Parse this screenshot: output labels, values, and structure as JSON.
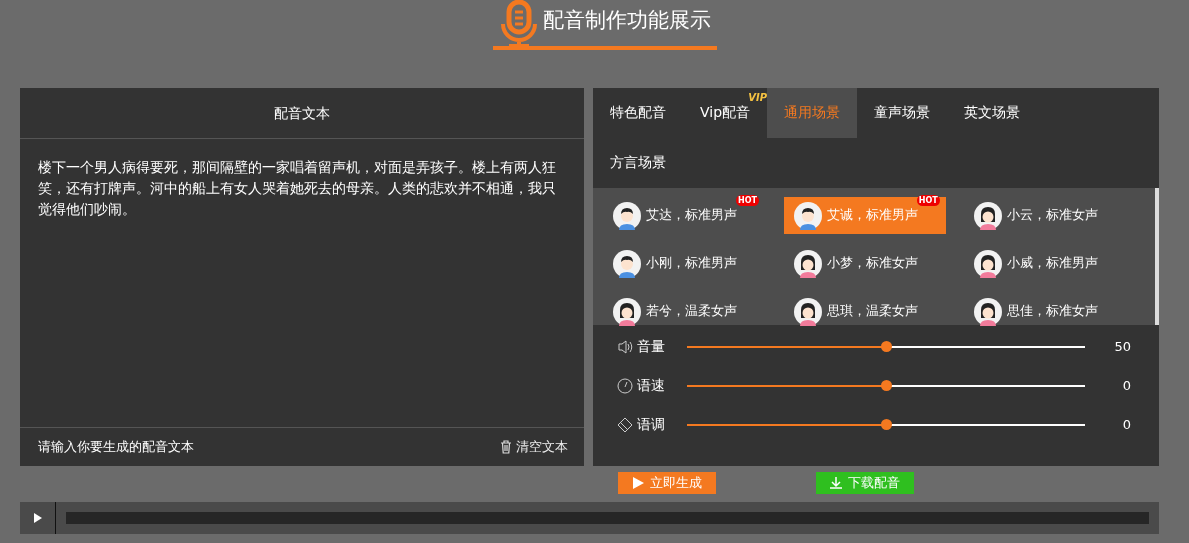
{
  "header": {
    "title": "配音制作功能展示"
  },
  "text_panel": {
    "title": "配音文本",
    "content": "楼下一个男人病得要死，那间隔壁的一家唱着留声机，对面是弄孩子。楼上有两人狂笑，还有打牌声。河中的船上有女人哭着她死去的母亲。人类的悲欢并不相通，我只觉得他们吵闹。",
    "hint": "请输入你要生成的配音文本",
    "clear_button": "清空文本"
  },
  "tabs": [
    {
      "label": "特色配音",
      "selected": false
    },
    {
      "label": "Vip配音",
      "selected": false,
      "badge": "VIP"
    },
    {
      "label": "通用场景",
      "selected": true
    },
    {
      "label": "童声场景",
      "selected": false
    },
    {
      "label": "英文场景",
      "selected": false
    },
    {
      "label": "方言场景",
      "selected": false
    }
  ],
  "voices": [
    {
      "label": "艾达，标准男声",
      "kind": "male",
      "selected": false,
      "badge": "HOT"
    },
    {
      "label": "艾诚，标准男声",
      "kind": "male",
      "selected": true,
      "badge": "HOT"
    },
    {
      "label": "小云，标准女声",
      "kind": "female",
      "selected": false
    },
    {
      "label": "小刚，标准男声",
      "kind": "male",
      "selected": false
    },
    {
      "label": "小梦，标准女声",
      "kind": "female",
      "selected": false
    },
    {
      "label": "小威，标准男声",
      "kind": "female",
      "selected": false
    },
    {
      "label": "若兮，温柔女声",
      "kind": "female",
      "selected": false
    },
    {
      "label": "思琪，温柔女声",
      "kind": "female",
      "selected": false
    },
    {
      "label": "思佳，标准女声",
      "kind": "female",
      "selected": false
    }
  ],
  "sliders": [
    {
      "kind": "volume",
      "label": "音量",
      "level": 0.5,
      "reading": "50"
    },
    {
      "kind": "speed",
      "label": "语速",
      "level": 0.5,
      "reading": "0"
    },
    {
      "kind": "pitch",
      "label": "语调",
      "level": 0.5,
      "reading": "0"
    }
  ],
  "player": {
    "level": 0
  },
  "actions": [
    {
      "kind": "generate",
      "label": "立即生成"
    },
    {
      "kind": "download",
      "label": "下载配音"
    }
  ]
}
